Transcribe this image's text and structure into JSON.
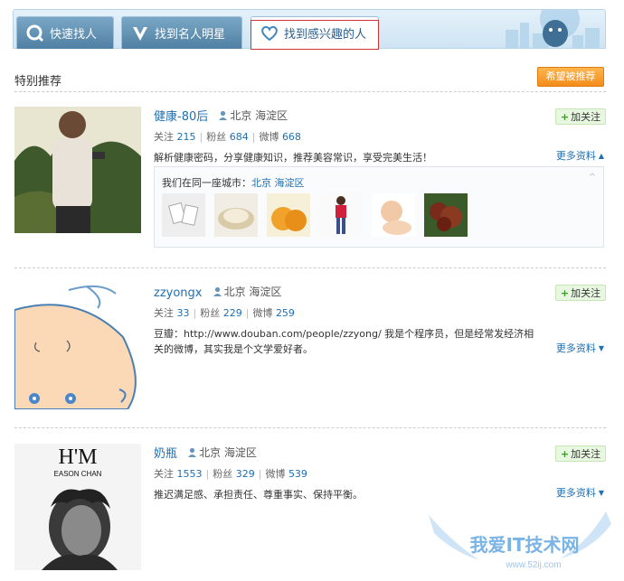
{
  "tabs": [
    {
      "label": "快速找人",
      "icon": "search-icon"
    },
    {
      "label": "找到名人明星",
      "icon": "v-verified-icon"
    },
    {
      "label": "找到感兴趣的人",
      "icon": "heart-icon"
    }
  ],
  "section": {
    "title": "特别推荐",
    "want_button": "希望被推荐"
  },
  "common": {
    "follow_label": "加关注",
    "more_label": "更多资料",
    "follow_prefix": "关注",
    "fans_prefix": "粉丝",
    "weibo_prefix": "微博"
  },
  "users": [
    {
      "name": "健康-80后",
      "location": "北京 海淀区",
      "follow_count": "215",
      "fans_count": "684",
      "weibo_count": "668",
      "bio": "解析健康密码，分享健康知识，推荐美容常识，享受完美生活！",
      "more_arrow": "▲",
      "city": {
        "prefix": "我们在同一座城市：",
        "place": "北京 海淀区"
      }
    },
    {
      "name": "zzyongx",
      "location": "北京 海淀区",
      "follow_count": "33",
      "fans_count": "229",
      "weibo_count": "259",
      "bio": "豆瓣：http://www.douban.com/people/zzyong/ 我是个程序员，但是经常发经济相关的微博，其实我是个文学爱好者。",
      "more_arrow": "▼"
    },
    {
      "name": "奶瓶",
      "location": "北京 海淀区",
      "follow_count": "1553",
      "fans_count": "329",
      "weibo_count": "539",
      "bio": "推迟满足感、承担责任、尊重事实、保持平衡。",
      "more_arrow": "▼",
      "avatar_text": {
        "big": "H'M",
        "small": "EASON CHAN"
      }
    }
  ],
  "watermark": {
    "text": "我爱IT技术网",
    "url": "www.52ij.com"
  },
  "colors": {
    "link": "#1f6fb2",
    "accent_orange": "#f28c1b",
    "follow_green": "#3a9d23"
  }
}
